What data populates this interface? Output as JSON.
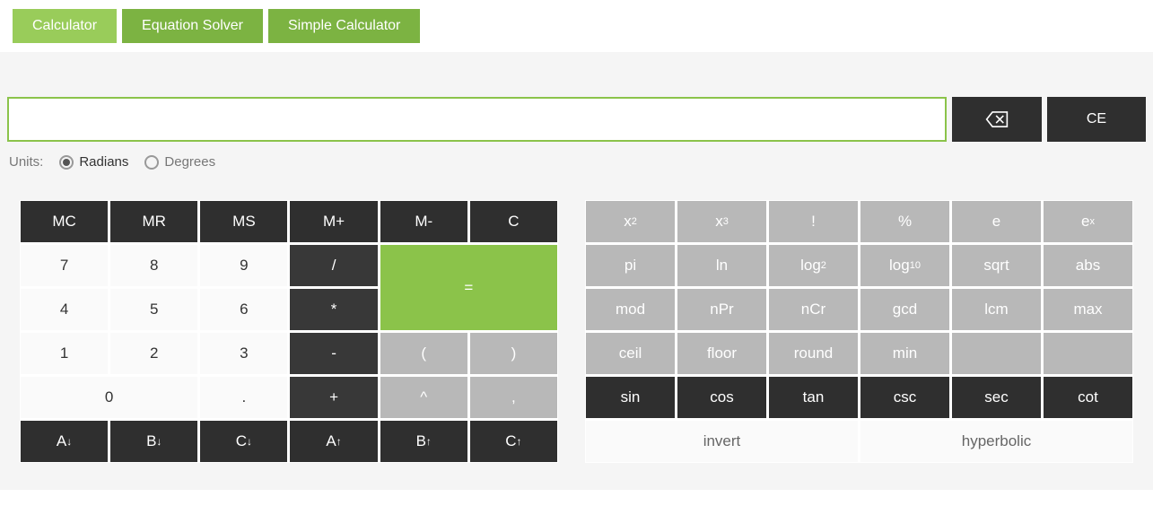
{
  "tabs": {
    "calculator": "Calculator",
    "equation_solver": "Equation Solver",
    "simple_calculator": "Simple Calculator"
  },
  "input": {
    "value": "",
    "ce": "CE"
  },
  "units": {
    "label": "Units:",
    "radians": "Radians",
    "degrees": "Degrees"
  },
  "left": {
    "mc": "MC",
    "mr": "MR",
    "ms": "MS",
    "mplus": "M+",
    "mminus": "M-",
    "c": "C",
    "n7": "7",
    "n8": "8",
    "n9": "9",
    "div": "/",
    "eq": "=",
    "n4": "4",
    "n5": "5",
    "n6": "6",
    "mul": "*",
    "n1": "1",
    "n2": "2",
    "n3": "3",
    "min": "-",
    "lp": "(",
    "rp": ")",
    "n0": "0",
    "dot": ".",
    "plus": "+",
    "pow": "^",
    "comma": ",",
    "ad": "A",
    "au": "A",
    "bd": "B",
    "bu": "B",
    "cd": "C",
    "cu": "C",
    "down": "↓",
    "up": "↑"
  },
  "right": {
    "x2_base": "x",
    "x2_sup": "2",
    "x3_base": "x",
    "x3_sup": "3",
    "fact": "!",
    "pct": "%",
    "e": "e",
    "ex_base": "e",
    "ex_sup": "x",
    "pi": "pi",
    "ln": "ln",
    "log2_base": "log",
    "log2_sub": "2",
    "log10_base": "log",
    "log10_sub": "10",
    "sqrt": "sqrt",
    "abs": "abs",
    "mod": "mod",
    "npr": "nPr",
    "ncr": "nCr",
    "gcd": "gcd",
    "lcm": "lcm",
    "max": "max",
    "ceil": "ceil",
    "floor": "floor",
    "round": "round",
    "min": "min",
    "sin": "sin",
    "cos": "cos",
    "tan": "tan",
    "csc": "csc",
    "sec": "sec",
    "cot": "cot",
    "invert": "invert",
    "hyperbolic": "hyperbolic"
  }
}
